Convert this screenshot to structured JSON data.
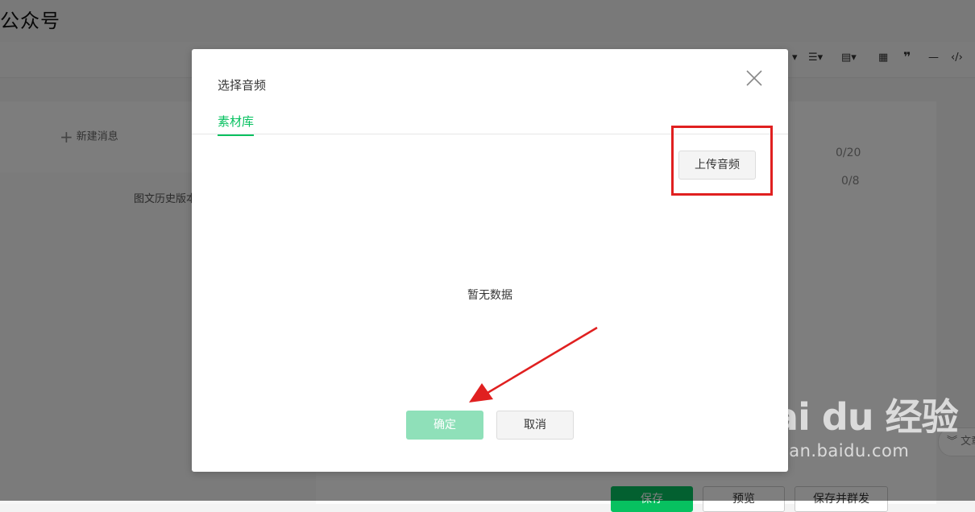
{
  "page": {
    "title": "公众号",
    "new_message": "新建消息",
    "history_label": "图文历史版本",
    "title_count": "0/20",
    "author_count": "0/8",
    "side_pill": "文章",
    "bottom_buttons": [
      "保存",
      "预览",
      "保存并群发"
    ]
  },
  "toolbar": {
    "icons": [
      "list-icon",
      "align-icon",
      "table-icon",
      "quote-icon",
      "divider-icon",
      "code-icon"
    ]
  },
  "modal": {
    "title": "选择音频",
    "tab": "素材库",
    "upload_label": "上传音频",
    "empty_text": "暂无数据",
    "ok_label": "确定",
    "cancel_label": "取消",
    "ok_enabled": false
  },
  "annotations": {
    "highlight_color": "#e02020",
    "arrow_color": "#e02020"
  },
  "watermark": {
    "brand": "Bai du 经验",
    "url": "jingyan.baidu.com"
  },
  "colors": {
    "accent": "#07c160",
    "accent_disabled": "#8fe0b9"
  }
}
